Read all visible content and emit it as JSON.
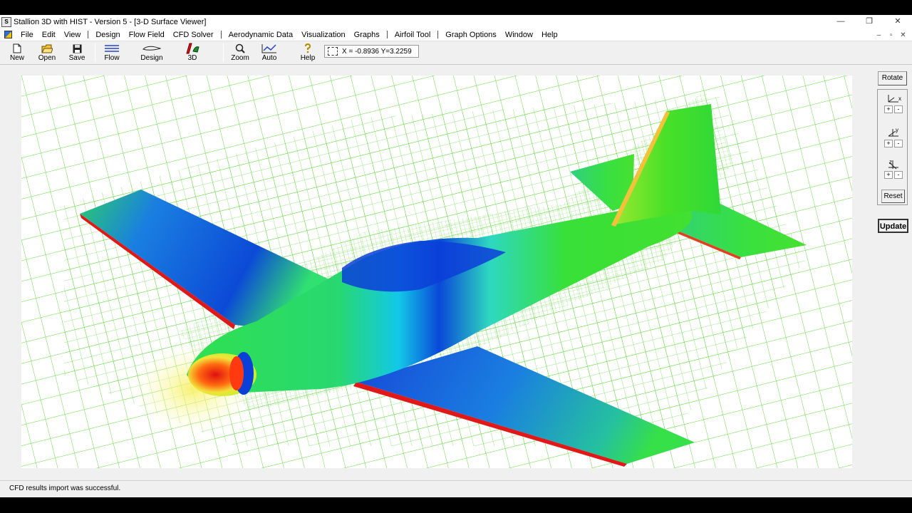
{
  "window": {
    "title": "Stallion 3D with HIST - Version 5 - [3-D Surface Viewer]",
    "app_icon_text": "S",
    "controls": [
      "—",
      "❐",
      "✕"
    ]
  },
  "menubar": {
    "items": [
      "File",
      "Edit",
      "View",
      "Design",
      "Flow Field",
      "CFD Solver",
      "Aerodynamic Data",
      "Visualization",
      "Graphs",
      "Airfoil Tool",
      "Graph Options",
      "Window",
      "Help"
    ],
    "mdi_controls": [
      "–",
      "▫",
      "✕"
    ]
  },
  "toolbar": {
    "new_label": "New",
    "open_label": "Open",
    "save_label": "Save",
    "flow_label": "Flow",
    "design_label": "Design",
    "threed_label": "3D",
    "zoom_label": "Zoom",
    "auto_label": "Auto",
    "help_label": "Help",
    "coord_readout": "X = -0.8936  Y=3.2259"
  },
  "side_panel": {
    "rotate_label": "Rotate",
    "x_axis_label": "x",
    "y_axis_label": "y",
    "z_axis_label": "z",
    "plus": "+",
    "minus": "-",
    "reset_label": "Reset",
    "update_label": "Update"
  },
  "status": {
    "message": "CFD results import was successful."
  },
  "colors": {
    "mesh": "#5fdc3a",
    "pressure_low": "#0a3fd8",
    "pressure_mid": "#1ee05a",
    "pressure_high": "#e01010",
    "accent_yellow": "#f2e23a"
  }
}
